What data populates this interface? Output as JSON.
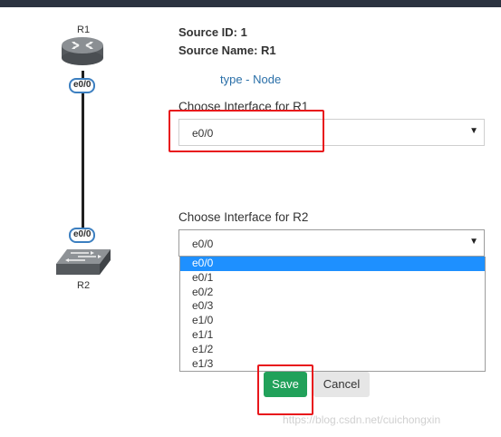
{
  "diagram": {
    "node_top": {
      "name": "R1",
      "icon": "router-icon",
      "interface": "e0/0"
    },
    "node_bottom": {
      "name": "R2",
      "icon": "switch-icon",
      "interface": "e0/0"
    }
  },
  "form": {
    "source_id": "Source ID: 1",
    "source_name": "Source Name: R1",
    "type_link": "type - Node",
    "r1": {
      "label": "Choose Interface for R1",
      "selected": "e0/0"
    },
    "r2": {
      "label": "Choose Interface for R2",
      "selected": "e0/0",
      "options": [
        "e0/0",
        "e0/1",
        "e0/2",
        "e0/3",
        "e1/0",
        "e1/1",
        "e1/2",
        "e1/3"
      ],
      "highlighted_option": "e0/0"
    },
    "save_label": "Save",
    "cancel_label": "Cancel"
  },
  "watermark": "https://blog.csdn.net/cuichongxin",
  "colors": {
    "save_button": "#21a15a",
    "annotation_box": "#e8161b",
    "option_highlight": "#1e90ff",
    "interface_pill_border": "#3c7fc0"
  }
}
